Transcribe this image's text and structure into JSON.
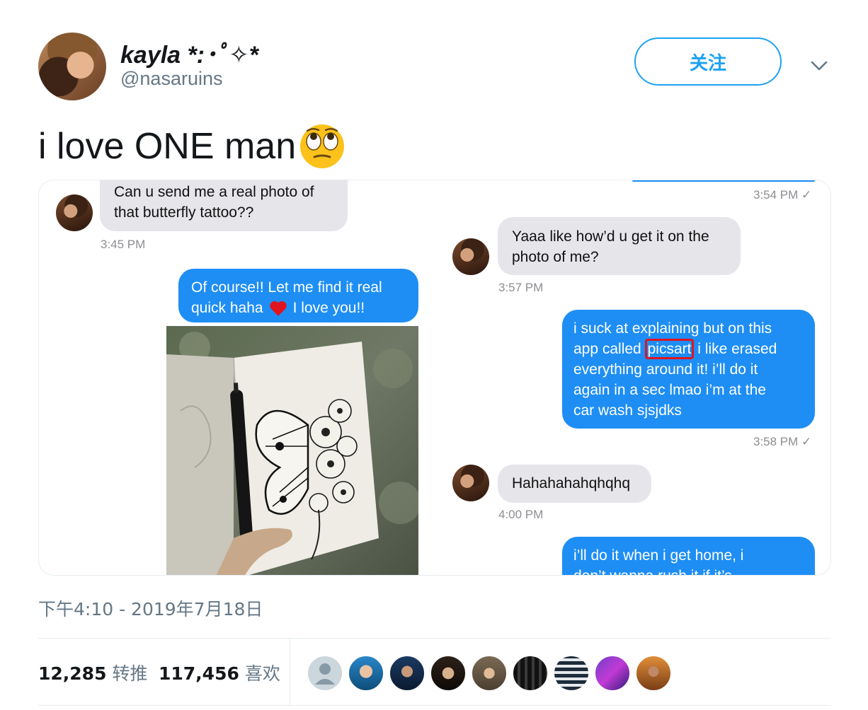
{
  "author": {
    "display_name": "kayla *:･ﾟ✧*",
    "handle": "@nasaruins"
  },
  "follow_button": {
    "label": "关注"
  },
  "tweet": {
    "text": "i love ONE man",
    "emoji": "face-with-rolling-eyes-emoji",
    "timestamp": "下午4:10 - 2019年7月18日"
  },
  "screenshot_left": {
    "msg1": {
      "lines": [
        "Can u send me a real photo of",
        "that butterfly tattoo??"
      ],
      "time": "3:45 PM"
    },
    "msg2": {
      "line1": "Of course!! Let me find it real",
      "line2a": "quick haha",
      "line2b": "I love you!!"
    }
  },
  "screenshot_right": {
    "top_time": "3:54 PM ✓",
    "msg1": {
      "lines": [
        "Yaaa like how’d u get it on the",
        "photo of me?"
      ],
      "time": "3:57 PM"
    },
    "msg2": {
      "pre": "i suck at explaining but on this",
      "line2_pre": "app called",
      "highlight": "picsart",
      "line2_post": " i like erased",
      "line3": "everything around it! i’ll do it",
      "line4": "again in a sec lmao i’m at the",
      "line5": "car wash sjsjdks",
      "time": "3:58 PM ✓"
    },
    "msg3": {
      "text": "Hahahahahqhqhq",
      "time": "4:00 PM"
    },
    "msg4": {
      "line1": "i’ll do it when i get home, i",
      "line2": "don’t wanna rush it if it’s"
    }
  },
  "stats": {
    "retweets": {
      "count": "12,285",
      "label": "转推"
    },
    "likes": {
      "count": "117,456",
      "label": "喜欢"
    }
  },
  "colors": {
    "accent": "#1da1f2",
    "imessage_blue": "#1e8ef4",
    "imessage_gray": "#e5e5ea",
    "highlight_red": "#e0141e"
  }
}
